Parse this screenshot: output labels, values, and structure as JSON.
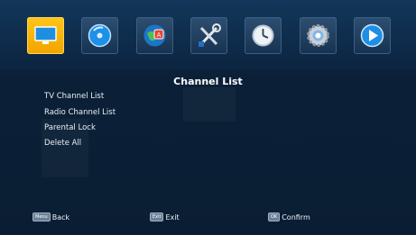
{
  "top_menu": [
    {
      "icon": "tv-icon",
      "active": true
    },
    {
      "icon": "disc-icon",
      "active": false
    },
    {
      "icon": "globe-icon",
      "active": false
    },
    {
      "icon": "tools-icon",
      "active": false
    },
    {
      "icon": "clock-icon",
      "active": false
    },
    {
      "icon": "settings-gear-icon",
      "active": false
    },
    {
      "icon": "play-icon",
      "active": false
    }
  ],
  "title": "Channel List",
  "menu": {
    "items": [
      "TV Channel List",
      "Radio Channel List",
      "Parental Lock",
      "Delete All"
    ]
  },
  "hints": {
    "back": {
      "key": "Menu",
      "label": "Back"
    },
    "exit": {
      "key": "Exit",
      "label": "Exit"
    },
    "confirm": {
      "key": "OK",
      "label": "Confirm"
    }
  },
  "colors": {
    "background": "#0b2037",
    "active_tile": "#f7b300",
    "tile": "#23415f"
  }
}
